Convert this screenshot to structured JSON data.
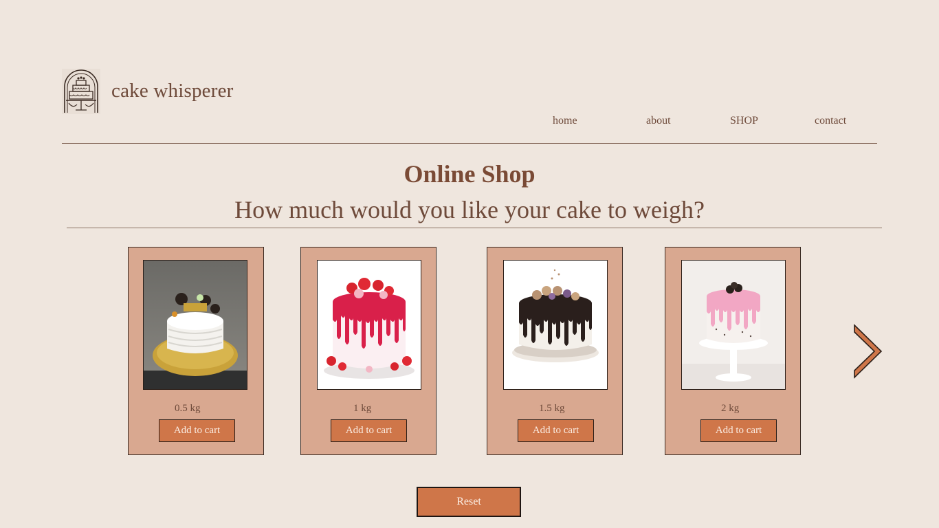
{
  "brand": {
    "name": "cake whisperer",
    "logo": "tiered-cake-arch-logo"
  },
  "nav": {
    "items": [
      "home",
      "about",
      "SHOP",
      "contact"
    ]
  },
  "page": {
    "title": "Online Shop",
    "subtitle": "How much would you like your cake to weigh?"
  },
  "products": [
    {
      "weight": "0.5 kg",
      "button": "Add to cart",
      "image": "white-cake-with-cookies"
    },
    {
      "weight": "1 kg",
      "button": "Add to cart",
      "image": "strawberry-drip-cake"
    },
    {
      "weight": "1.5 kg",
      "button": "Add to cart",
      "image": "chocolate-drip-cake"
    },
    {
      "weight": "2 kg",
      "button": "Add to cart",
      "image": "pink-drip-cake-on-stand"
    }
  ],
  "controls": {
    "reset_label": "Reset",
    "next_icon": "chevron-right-icon"
  },
  "colors": {
    "background": "#EFE6DE",
    "card": "#D9A890",
    "button": "#CF7649",
    "text": "#6E4A3A"
  }
}
